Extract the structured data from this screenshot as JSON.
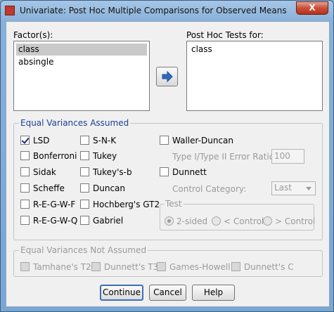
{
  "window": {
    "title": "Univariate: Post Hoc Multiple Comparisons for Observed Means",
    "close_label": "X"
  },
  "factors": {
    "label": "Factor(s):",
    "items": [
      "class",
      "absingle"
    ]
  },
  "post_hoc": {
    "label": "Post Hoc Tests for:",
    "items": [
      "class"
    ]
  },
  "equal_var": {
    "title": "Equal Variances Assumed",
    "lsd": "LSD",
    "bonferroni": "Bonferroni",
    "sidak": "Sidak",
    "scheffe": "Scheffe",
    "regwf": "R-E-G-W-F",
    "regwq": "R-E-G-W-Q",
    "snk": "S-N-K",
    "tukey": "Tukey",
    "tukeyb": "Tukey's-b",
    "duncan": "Duncan",
    "hochberg": "Hochberg's GT2",
    "gabriel": "Gabriel",
    "waller": "Waller-Duncan",
    "error_ratio_label": "Type I/Type II Error Ratio:",
    "error_ratio_value": "100",
    "dunnett": "Dunnett",
    "control_label": "Control Category:",
    "control_value": "Last",
    "test_title": "Test",
    "two_sided": "2-sided",
    "lt_control": "< Control",
    "gt_control": "> Control"
  },
  "unequal_var": {
    "title": "Equal Variances Not Assumed",
    "tamhane": "Tamhane's T2",
    "dunnett_t3": "Dunnett's T3",
    "games_howell": "Games-Howell",
    "dunnett_c": "Dunnett's C"
  },
  "buttons": {
    "continue": "Continue",
    "cancel": "Cancel",
    "help": "Help"
  }
}
